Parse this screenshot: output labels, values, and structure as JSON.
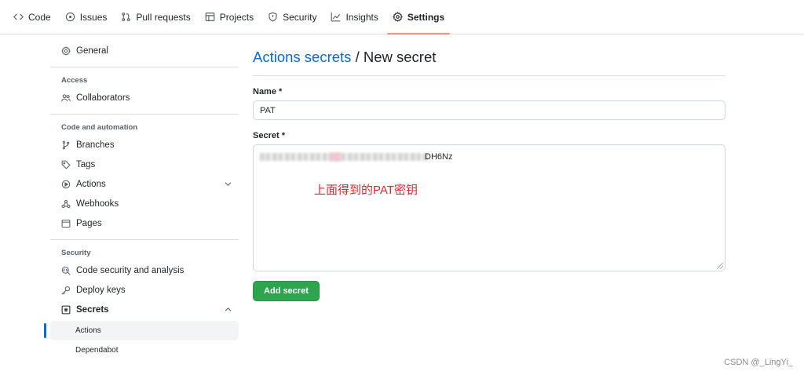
{
  "topnav": {
    "tabs": [
      {
        "label": "Code",
        "icon": "code-icon"
      },
      {
        "label": "Issues",
        "icon": "issue-opened-icon"
      },
      {
        "label": "Pull requests",
        "icon": "git-pull-request-icon"
      },
      {
        "label": "Projects",
        "icon": "table-icon"
      },
      {
        "label": "Security",
        "icon": "shield-icon"
      },
      {
        "label": "Insights",
        "icon": "graph-icon"
      },
      {
        "label": "Settings",
        "icon": "gear-icon",
        "active": true
      }
    ]
  },
  "sidebar": {
    "general": "General",
    "access_heading": "Access",
    "collaborators": "Collaborators",
    "code_heading": "Code and automation",
    "branches": "Branches",
    "tags": "Tags",
    "actions": "Actions",
    "webhooks": "Webhooks",
    "pages": "Pages",
    "security_heading": "Security",
    "code_security": "Code security and analysis",
    "deploy_keys": "Deploy keys",
    "secrets": "Secrets",
    "secrets_actions": "Actions",
    "secrets_dependabot": "Dependabot"
  },
  "main": {
    "breadcrumb_link": "Actions secrets",
    "breadcrumb_sep": " / ",
    "breadcrumb_current": "New secret",
    "name_label": "Name *",
    "name_value": "PAT",
    "secret_label": "Secret *",
    "secret_visible_tail": "DH6Nz",
    "annotation": "上面得到的PAT密钥",
    "add_button": "Add secret"
  },
  "watermark": "CSDN @_LingYi_",
  "colors": {
    "link": "#0969da",
    "active_tab_underline": "#fd8c73",
    "button_green": "#2da44e",
    "annotation_red": "#e8242b"
  }
}
